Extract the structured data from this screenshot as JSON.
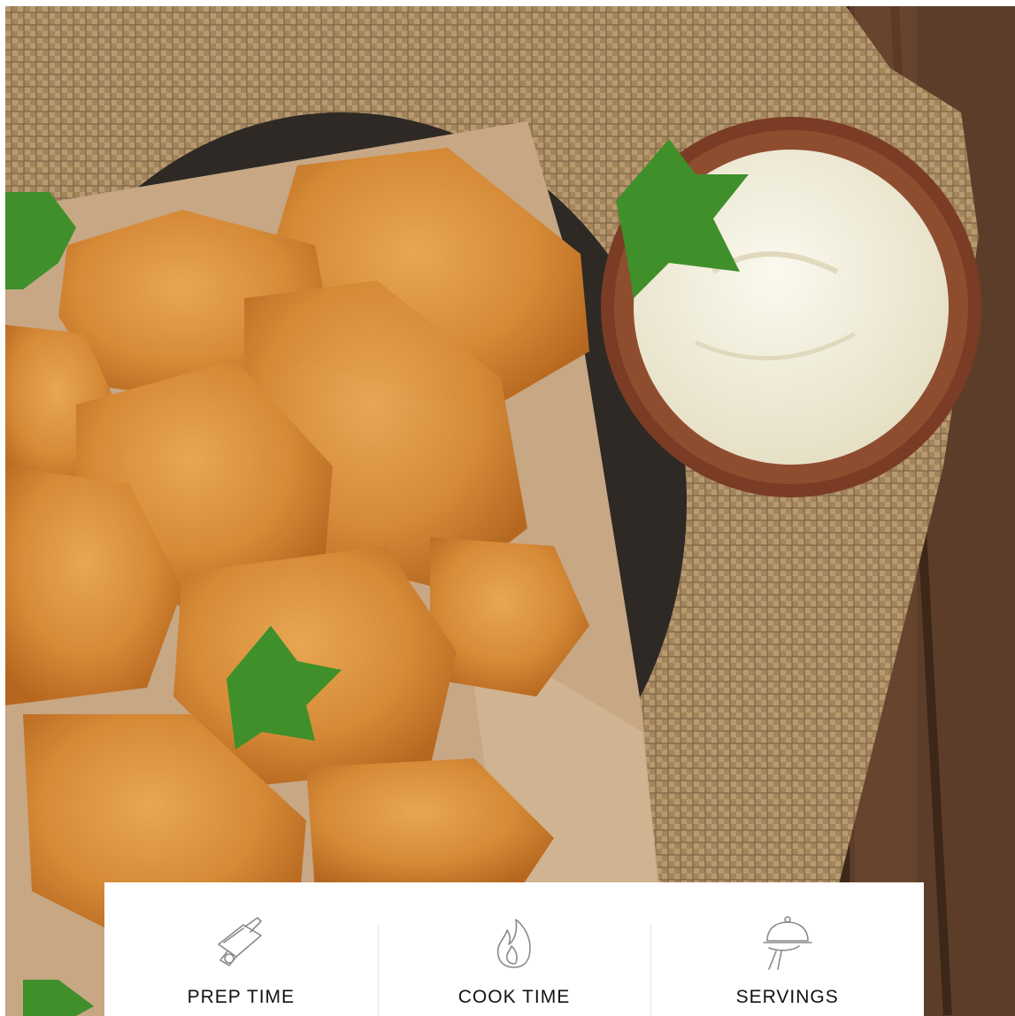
{
  "photo": {
    "subject": "fried chicken nuggets on parchment with a bowl of white dipping sauce and parsley on burlap over a wooden table",
    "colors": {
      "wood": "#5e3e2a",
      "burlap": "#a88a62",
      "parchment": "#c9ab86",
      "nugget": "#d98f3c",
      "sauce": "#f3f0e2",
      "bowl": "#7a3f26",
      "parsley": "#3f8f2a"
    }
  },
  "recipe_info": {
    "items": [
      {
        "icon": "cutting-board-icon",
        "label": "PREP TIME"
      },
      {
        "icon": "flame-icon",
        "label": "COOK TIME"
      },
      {
        "icon": "serving-cloche-icon",
        "label": "SERVINGS"
      }
    ]
  }
}
